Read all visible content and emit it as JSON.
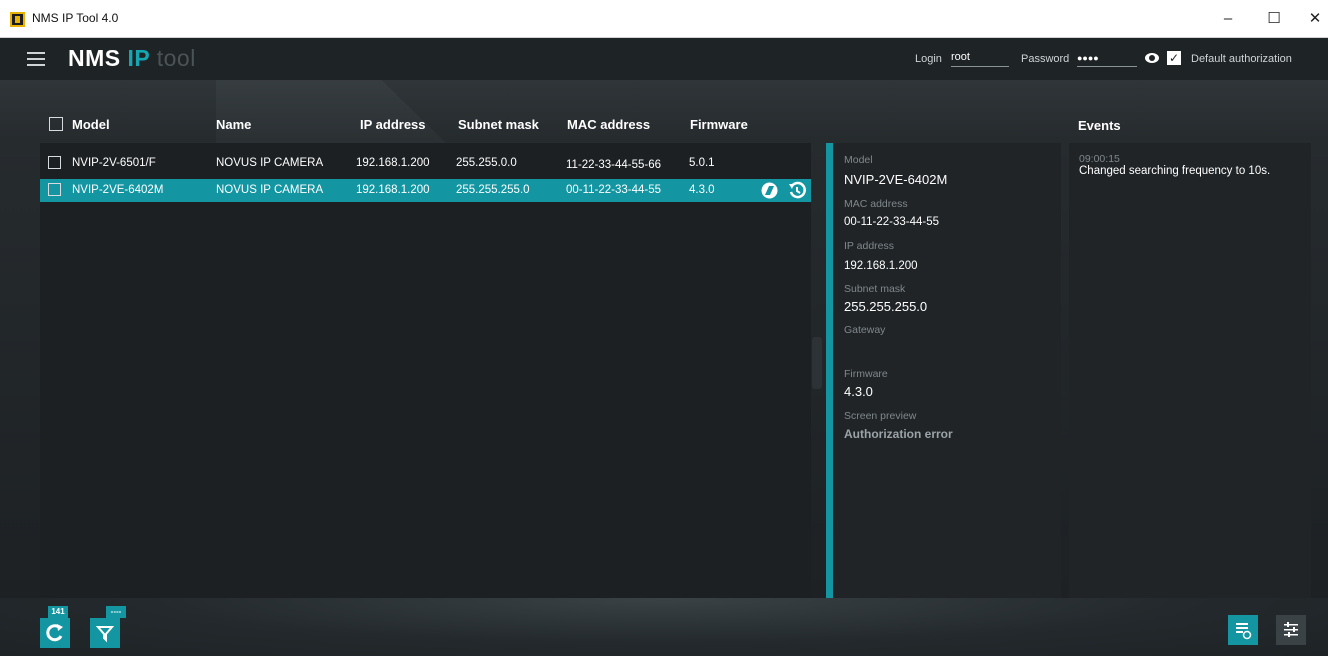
{
  "window": {
    "title": "NMS IP Tool 4.0",
    "minimize": "–",
    "maximize": "☐",
    "close": "✕"
  },
  "header": {
    "brand_main": "NMS",
    "brand_ip": "IP",
    "brand_tool": "tool",
    "login_label": "Login",
    "login_value": "root",
    "password_label": "Password",
    "password_value": "●●●●",
    "default_auth_checked": "✓",
    "default_auth_label": "Default authorization"
  },
  "table": {
    "columns": [
      "Model",
      "Name",
      "IP address",
      "Subnet mask",
      "MAC address",
      "Firmware"
    ],
    "rows": [
      {
        "model": "NVIP-2V-6501/F",
        "name": "NOVUS IP CAMERA",
        "ip": "192.168.1.200",
        "mask": "255.255.0.0",
        "mac": "11-22-33-44-55-66",
        "firmware": "5.0.1",
        "selected": false
      },
      {
        "model": "NVIP-2VE-6402M",
        "name": "NOVUS IP CAMERA",
        "ip": "192.168.1.200",
        "mask": "255.255.255.0",
        "mac": "00-11-22-33-44-55",
        "firmware": "4.3.0",
        "selected": true
      }
    ]
  },
  "details": {
    "model_label": "Model",
    "model_value": "NVIP-2VE-6402M",
    "mac_label": "MAC address",
    "mac_value": "00-11-22-33-44-55",
    "ip_label": "IP address",
    "ip_value": "192.168.1.200",
    "mask_label": "Subnet mask",
    "mask_value": "255.255.255.0",
    "gateway_label": "Gateway",
    "gateway_value": "",
    "firmware_label": "Firmware",
    "firmware_value": "4.3.0",
    "preview_label": "Screen preview",
    "preview_value": "Authorization error"
  },
  "events": {
    "title": "Events",
    "items": [
      {
        "time": "09:00:15",
        "text": "Changed searching frequency to 10s."
      }
    ]
  },
  "toolbar": {
    "refresh_badge": "141",
    "filter_badge": "----",
    "refresh_icon": "refresh-icon",
    "filter_icon": "filter-icon"
  },
  "colors": {
    "accent": "#1396a2",
    "background": "#1b1f22"
  }
}
